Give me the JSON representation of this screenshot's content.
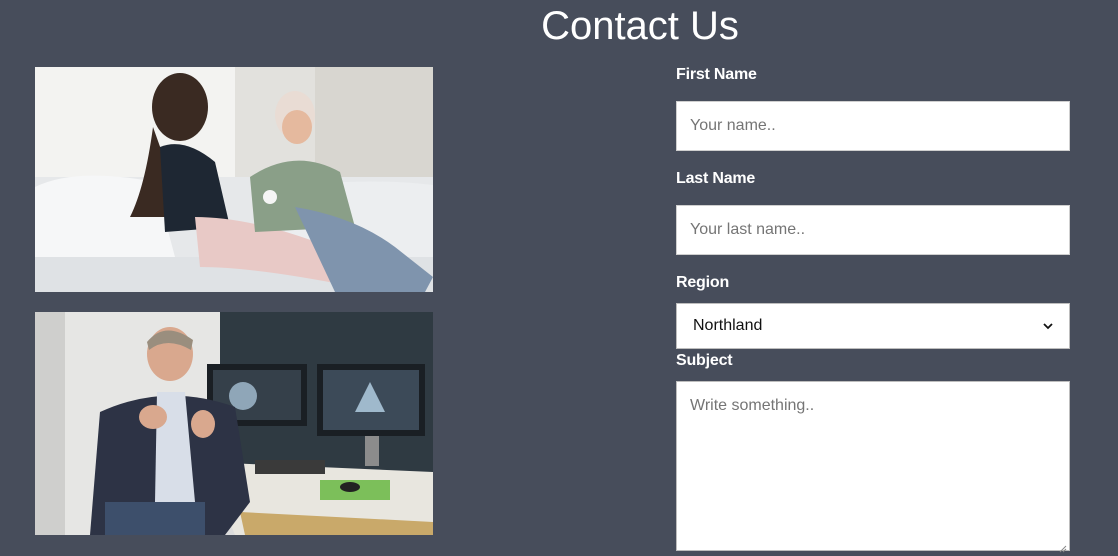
{
  "page": {
    "title": "Contact Us"
  },
  "form": {
    "first_name": {
      "label": "First Name",
      "placeholder": "Your name.."
    },
    "last_name": {
      "label": "Last Name",
      "placeholder": "Your last name.."
    },
    "region": {
      "label": "Region",
      "selected": "Northland"
    },
    "subject": {
      "label": "Subject",
      "placeholder": "Write something.."
    }
  },
  "colors": {
    "background": "#474d5b",
    "field": "#ffffff",
    "text": "#ffffff"
  }
}
